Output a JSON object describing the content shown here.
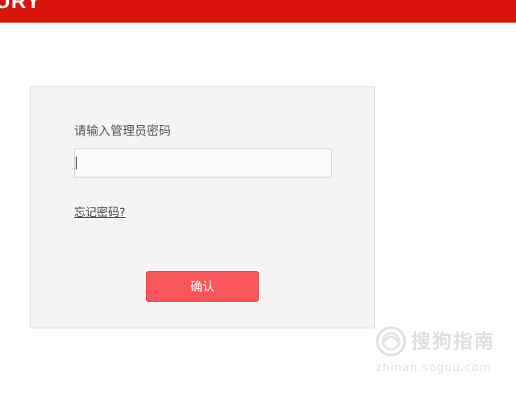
{
  "header": {
    "brand_text": "URY",
    "bar_color": "#d9150c"
  },
  "login_panel": {
    "prompt": "请输入管理员密码",
    "password_value": "",
    "forgot_link": "忘记密码?",
    "confirm_label": "确认",
    "confirm_color": "#fa565a"
  },
  "watermark": {
    "icon": "sogou-logo-icon",
    "text": "搜狗指南",
    "subtext": "zhinan.sogou.com"
  }
}
